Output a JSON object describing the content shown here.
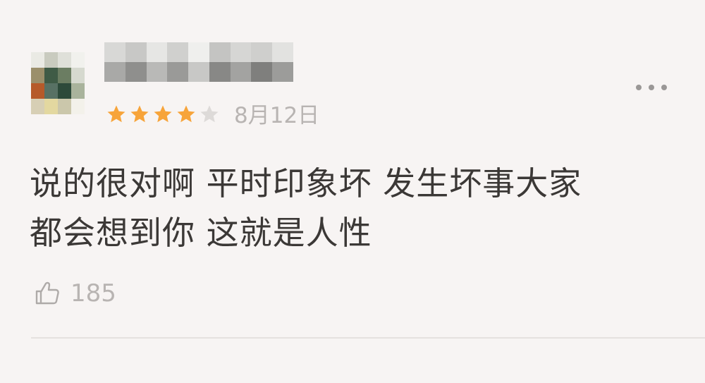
{
  "comment": {
    "user": {
      "name": "",
      "avatar_description": "blurred"
    },
    "rating": {
      "value": 4,
      "max": 5,
      "filled_color": "#f7a43a",
      "empty_color": "#dddad8"
    },
    "date": "8月12日",
    "text_lines": [
      "说的很对啊 平时印象坏 发生坏事大家",
      "都会想到你 这就是人性"
    ],
    "likes": {
      "icon": "thumbs-up-icon",
      "count": "185"
    },
    "more_icon": "more-options-icon"
  }
}
